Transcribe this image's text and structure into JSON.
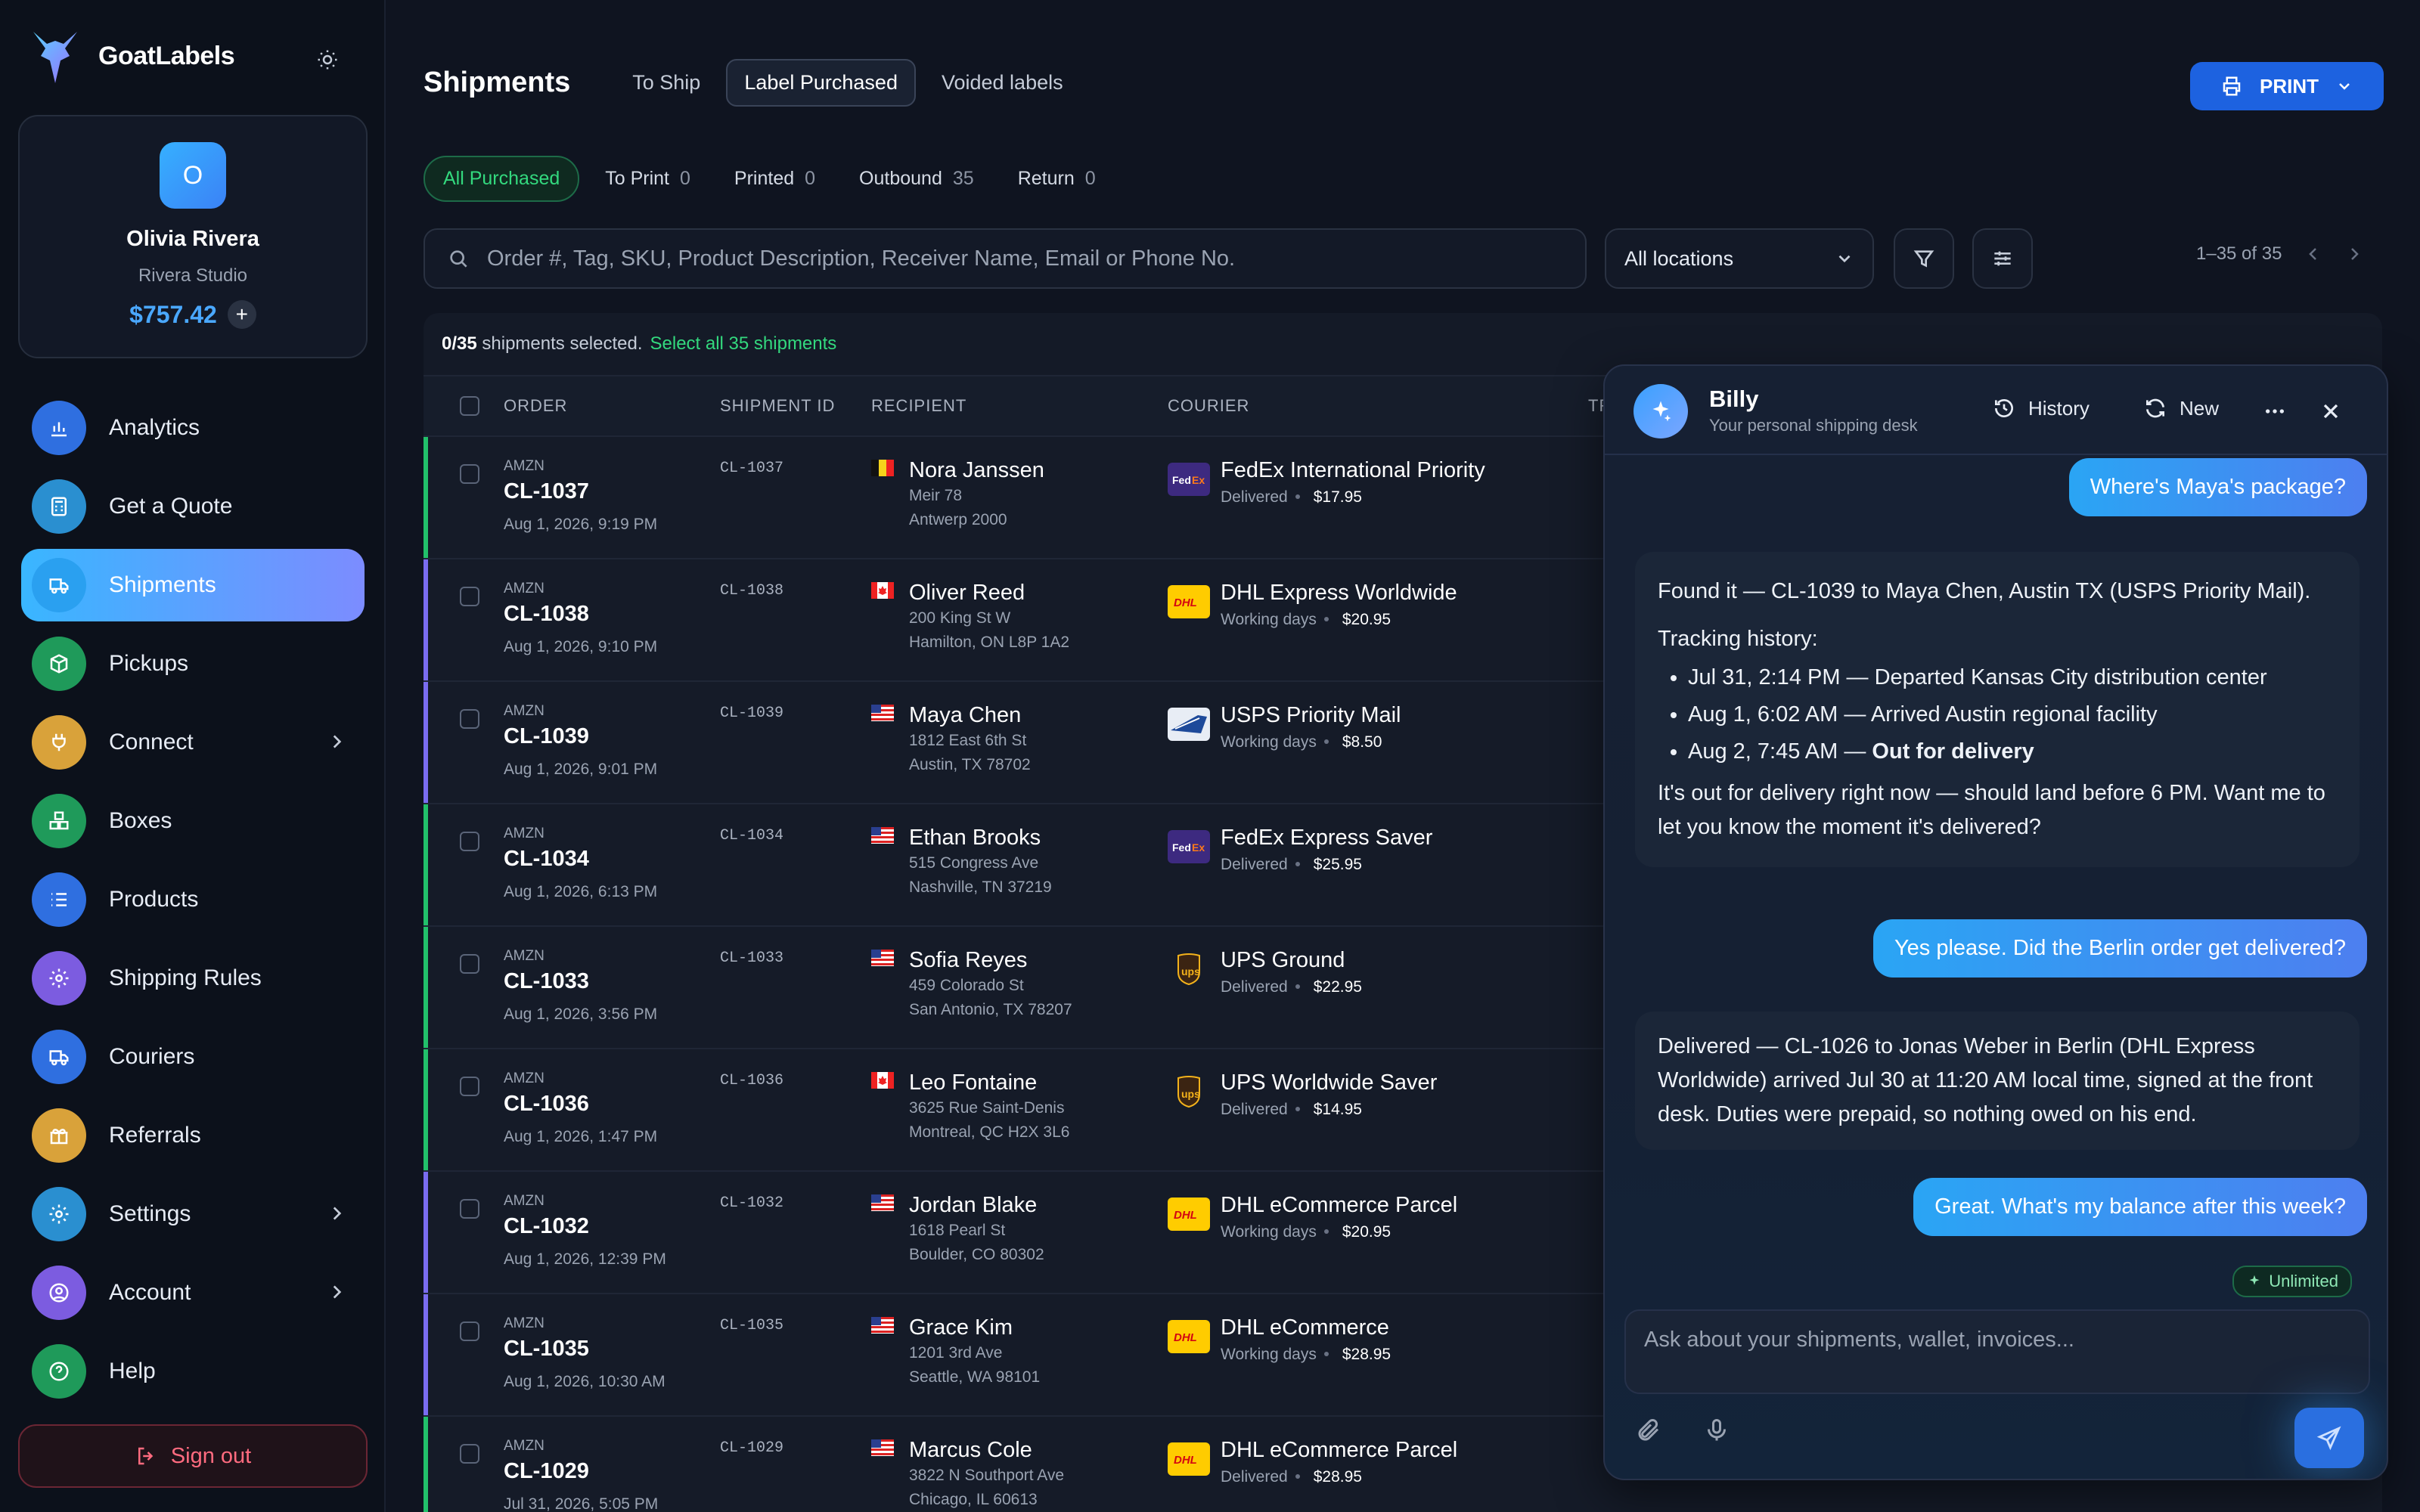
{
  "brand": {
    "name": "GoatLabels"
  },
  "profile": {
    "initial": "O",
    "name": "Olivia Rivera",
    "studio": "Rivera Studio",
    "balance": "$757.42",
    "add": "+"
  },
  "nav": [
    {
      "label": "Analytics",
      "icon": "analytics-icon",
      "color": "#2f6fe0"
    },
    {
      "label": "Get a Quote",
      "icon": "calculator-icon",
      "color": "#2a8fd0"
    },
    {
      "label": "Shipments",
      "icon": "truck-icon",
      "color": "#2a9fe8"
    },
    {
      "label": "Pickups",
      "icon": "box-icon",
      "color": "#1f9a5a"
    },
    {
      "label": "Connect",
      "icon": "plug-icon",
      "color": "#d9a23a"
    },
    {
      "label": "Boxes",
      "icon": "boxes-icon",
      "color": "#1f9a5a"
    },
    {
      "label": "Products",
      "icon": "list-icon",
      "color": "#2f6fe0"
    },
    {
      "label": "Shipping Rules",
      "icon": "gear-icon",
      "color": "#7c5ce0"
    },
    {
      "label": "Couriers",
      "icon": "truck-icon",
      "color": "#2f6fe0"
    },
    {
      "label": "Referrals",
      "icon": "gift-icon",
      "color": "#d9a23a"
    },
    {
      "label": "Settings",
      "icon": "gear-icon",
      "color": "#2a8fd0"
    },
    {
      "label": "Account",
      "icon": "user-icon",
      "color": "#7c5ce0"
    },
    {
      "label": "Help",
      "icon": "help-icon",
      "color": "#1f9a5a"
    }
  ],
  "signout": "Sign out",
  "header": {
    "title": "Shipments",
    "tabs": [
      "To Ship",
      "Label Purchased",
      "Voided labels"
    ],
    "print": "PRINT"
  },
  "subtabs": [
    {
      "label": "All Purchased",
      "count": ""
    },
    {
      "label": "To Print",
      "count": "0"
    },
    {
      "label": "Printed",
      "count": "0"
    },
    {
      "label": "Outbound",
      "count": "35"
    },
    {
      "label": "Return",
      "count": "0"
    }
  ],
  "search": {
    "placeholder": "Order #, Tag, SKU, Product Description, Receiver Name, Email or Phone No."
  },
  "location": "All locations",
  "pager": "1–35 of 35",
  "selection": {
    "count": "0/35",
    "text": "shipments selected.",
    "link": "Select all 35 shipments"
  },
  "columns": [
    "ORDER",
    "SHIPMENT ID",
    "RECIPIENT",
    "COURIER",
    "TR"
  ],
  "rows": [
    {
      "src": "AMZN",
      "order": "CL-1037",
      "date": "Aug 1, 2026, 9:19 PM",
      "sid": "CL-1037",
      "name": "Nora Janssen",
      "a1": "Meir 78",
      "a2": "Antwerp 2000",
      "courier": "FedEx International Priority",
      "status": "Delivered",
      "price": "$17.95"
    },
    {
      "src": "AMZN",
      "order": "CL-1038",
      "date": "Aug 1, 2026, 9:10 PM",
      "sid": "CL-1038",
      "name": "Oliver Reed",
      "a1": "200 King St W",
      "a2": "Hamilton, ON L8P 1A2",
      "courier": "DHL Express Worldwide",
      "status": "Working days",
      "price": "$20.95"
    },
    {
      "src": "AMZN",
      "order": "CL-1039",
      "date": "Aug 1, 2026, 9:01 PM",
      "sid": "CL-1039",
      "name": "Maya Chen",
      "a1": "1812 East 6th St",
      "a2": "Austin, TX 78702",
      "courier": "USPS Priority Mail",
      "status": "Working days",
      "price": "$8.50"
    },
    {
      "src": "AMZN",
      "order": "CL-1034",
      "date": "Aug 1, 2026, 6:13 PM",
      "sid": "CL-1034",
      "name": "Ethan Brooks",
      "a1": "515 Congress Ave",
      "a2": "Nashville, TN 37219",
      "courier": "FedEx Express Saver",
      "status": "Delivered",
      "price": "$25.95"
    },
    {
      "src": "AMZN",
      "order": "CL-1033",
      "date": "Aug 1, 2026, 3:56 PM",
      "sid": "CL-1033",
      "name": "Sofia Reyes",
      "a1": "459 Colorado St",
      "a2": "San Antonio, TX 78207",
      "courier": "UPS Ground",
      "status": "Delivered",
      "price": "$22.95"
    },
    {
      "src": "AMZN",
      "order": "CL-1036",
      "date": "Aug 1, 2026, 1:47 PM",
      "sid": "CL-1036",
      "name": "Leo Fontaine",
      "a1": "3625 Rue Saint-Denis",
      "a2": "Montreal, QC H2X 3L6",
      "courier": "UPS Worldwide Saver",
      "status": "Delivered",
      "price": "$14.95"
    },
    {
      "src": "AMZN",
      "order": "CL-1032",
      "date": "Aug 1, 2026, 12:39 PM",
      "sid": "CL-1032",
      "name": "Jordan Blake",
      "a1": "1618 Pearl St",
      "a2": "Boulder, CO 80302",
      "courier": "DHL eCommerce Parcel",
      "status": "Working days",
      "price": "$20.95"
    },
    {
      "src": "AMZN",
      "order": "CL-1035",
      "date": "Aug 1, 2026, 10:30 AM",
      "sid": "CL-1035",
      "name": "Grace Kim",
      "a1": "1201 3rd Ave",
      "a2": "Seattle, WA 98101",
      "courier": "DHL eCommerce",
      "status": "Working days",
      "price": "$28.95"
    },
    {
      "src": "AMZN",
      "order": "CL-1029",
      "date": "Jul 31, 2026, 5:05 PM",
      "sid": "CL-1029",
      "name": "Marcus Cole",
      "a1": "3822 N Southport Ave",
      "a2": "Chicago, IL 60613",
      "courier": "DHL eCommerce Parcel",
      "status": "Delivered",
      "price": "$28.95"
    }
  ],
  "chat": {
    "name": "Billy",
    "subtitle": "Your personal shipping desk",
    "history": "History",
    "new": "New",
    "m1": "Where's Maya's package?",
    "b1_intro": "Found it — CL-1039 to Maya Chen, Austin TX (USPS Priority Mail).",
    "b1_th": "Tracking history:",
    "b1_l1": "Jul 31, 2:14 PM — Departed Kansas City distribution center",
    "b1_l2": "Aug 1, 6:02 AM — Arrived Austin regional facility",
    "b1_l3a": "Aug 2, 7:45 AM — ",
    "b1_l3b": "Out for delivery",
    "b1_end": "It's out for delivery right now — should land before 6 PM. Want me to let you know the moment it's delivered?",
    "m2": "Yes please. Did the Berlin order get delivered?",
    "b2": "Delivered — CL-1026 to Jonas Weber in Berlin (DHL Express Worldwide) arrived Jul 30 at 11:20 AM local time, signed at the front desk. Duties were prepaid, so nothing owed on his end.",
    "m3": "Great. What's my balance after this week?",
    "unlimited": "Unlimited",
    "input_placeholder": "Ask about your shipments, wallet, invoices..."
  }
}
